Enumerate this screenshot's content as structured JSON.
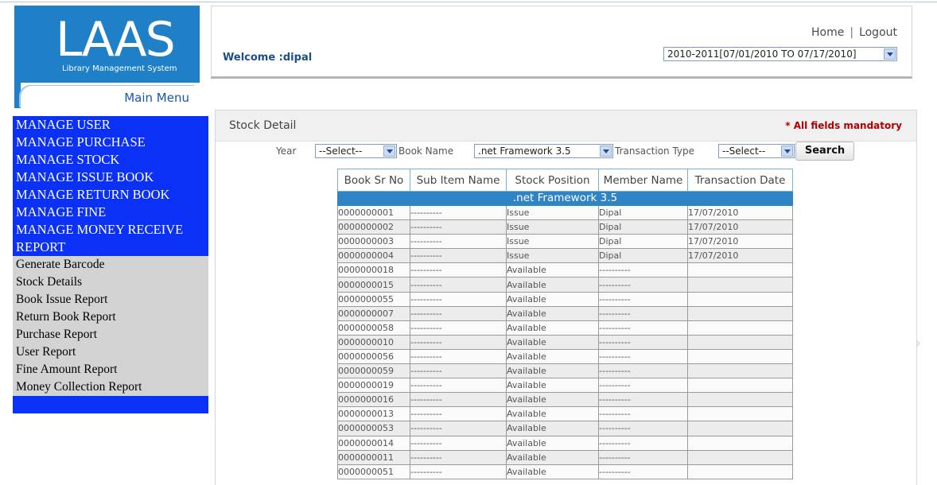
{
  "logo": {
    "letters": "LAAS",
    "subtitle": "Library Management System"
  },
  "main_menu_label": "Main Menu",
  "header": {
    "welcome": "Welcome :dipal",
    "nav": {
      "home": "Home",
      "separator": "|",
      "logout": "Logout"
    },
    "financial_year": "2010-2011[07/01/2010 TO 07/17/2010]"
  },
  "sidebar": {
    "manage_items": [
      "MANAGE USER",
      "MANAGE PURCHASE",
      "MANAGE STOCK",
      "MANAGE ISSUE BOOK",
      "MANAGE RETURN BOOK",
      "MANAGE FINE",
      "MANAGE MONEY RECEIVE",
      "REPORT"
    ],
    "report_items": [
      "Generate Barcode",
      "Stock Details",
      "Book Issue Report",
      "Return Book Report",
      "Purchase Report",
      "User Report",
      "Fine Amount Report",
      "Money Collection Report"
    ]
  },
  "panel": {
    "title": "Stock Detail",
    "mandatory": "* All fields mandatory",
    "filters": {
      "year_label": "Year",
      "year_value": "--Select--",
      "book_label": "Book Name",
      "book_value": ".net Framework 3.5",
      "txn_label": "Transaction Type",
      "txn_value": "--Select--",
      "search": "Search"
    }
  },
  "table": {
    "headers": [
      "Book Sr No",
      "Sub Item Name",
      "Stock Position",
      "Member Name",
      "Transaction Date"
    ],
    "group": ".net Framework 3.5",
    "rows": [
      [
        "0000000001",
        "----------",
        "Issue",
        "Dipal",
        "17/07/2010"
      ],
      [
        "0000000002",
        "----------",
        "Issue",
        "Dipal",
        "17/07/2010"
      ],
      [
        "0000000003",
        "----------",
        "Issue",
        "Dipal",
        "17/07/2010"
      ],
      [
        "0000000004",
        "----------",
        "Issue",
        "Dipal",
        "17/07/2010"
      ],
      [
        "0000000018",
        "----------",
        "Available",
        "----------",
        ""
      ],
      [
        "0000000015",
        "----------",
        "Available",
        "----------",
        ""
      ],
      [
        "0000000055",
        "----------",
        "Available",
        "----------",
        ""
      ],
      [
        "0000000007",
        "----------",
        "Available",
        "----------",
        ""
      ],
      [
        "0000000058",
        "----------",
        "Available",
        "----------",
        ""
      ],
      [
        "0000000010",
        "----------",
        "Available",
        "----------",
        ""
      ],
      [
        "0000000056",
        "----------",
        "Available",
        "----------",
        ""
      ],
      [
        "0000000059",
        "----------",
        "Available",
        "----------",
        ""
      ],
      [
        "0000000019",
        "----------",
        "Available",
        "----------",
        ""
      ],
      [
        "0000000016",
        "----------",
        "Available",
        "----------",
        ""
      ],
      [
        "0000000013",
        "----------",
        "Available",
        "----------",
        ""
      ],
      [
        "0000000053",
        "----------",
        "Available",
        "----------",
        ""
      ],
      [
        "0000000014",
        "----------",
        "Available",
        "----------",
        ""
      ],
      [
        "0000000011",
        "----------",
        "Available",
        "----------",
        ""
      ],
      [
        "0000000051",
        "----------",
        "Available",
        "----------",
        ""
      ]
    ]
  },
  "colors": {
    "sidebar_blue": "#0a31f5",
    "logo_blue": "#1f80c8",
    "table_group": "#2f84c6",
    "mandatory_red": "#b20000"
  }
}
